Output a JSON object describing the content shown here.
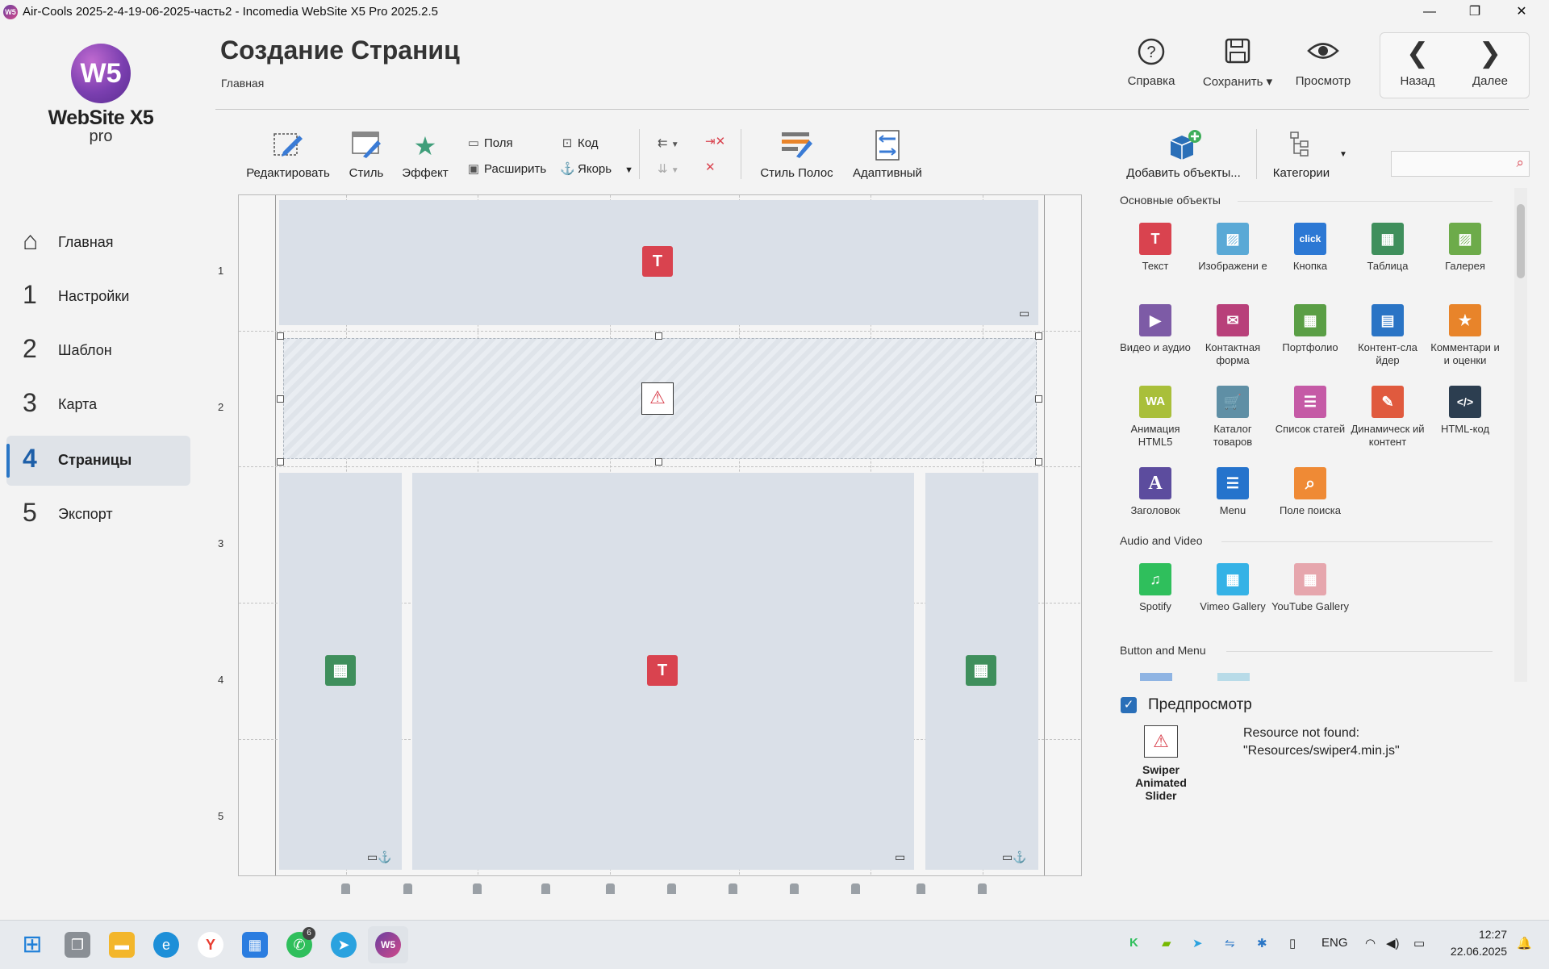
{
  "window": {
    "title": "Air-Cools 2025-2-4-19-06-2025-часть2 - Incomedia WebSite X5 Pro 2025.2.5",
    "app_icon": "W5",
    "controls": [
      "—",
      "❐",
      "✕"
    ]
  },
  "logo": {
    "mark": "W5",
    "name": "WebSite X5",
    "edition": "pro"
  },
  "sidebar": {
    "items": [
      {
        "num": "⌂",
        "label": "Главная",
        "icon": "home-icon"
      },
      {
        "num": "1",
        "label": "Настройки"
      },
      {
        "num": "2",
        "label": "Шаблон"
      },
      {
        "num": "3",
        "label": "Карта"
      },
      {
        "num": "4",
        "label": "Страницы",
        "active": true
      },
      {
        "num": "5",
        "label": "Экспорт"
      }
    ]
  },
  "header": {
    "title": "Создание Страниц",
    "breadcrumb": "Главная",
    "help": {
      "label": "Справка",
      "icon": "?"
    },
    "save": {
      "label": "Сохранить ▾",
      "icon": "💾"
    },
    "preview": {
      "label": "Просмотр",
      "icon": "👁"
    },
    "back": {
      "label": "Назад",
      "icon": "❮"
    },
    "next": {
      "label": "Далее",
      "icon": "❯"
    }
  },
  "toolbar": {
    "edit": "Редактировать",
    "style": "Стиль",
    "effect": "Эффект",
    "fields": "Поля",
    "expand": "Расширить",
    "code": "Код",
    "anchor": "Якорь",
    "strip_style": "Стиль Полос",
    "adaptive": "Адаптивный",
    "add_objects": "Добавить объекты...",
    "categories": "Категории",
    "search_placeholder": ""
  },
  "rows": [
    "1",
    "2",
    "3",
    "4",
    "5"
  ],
  "panel": {
    "sections": [
      {
        "title": "Основные объекты",
        "tiles": [
          {
            "label": "Текст",
            "glyph": "T",
            "color": "#d9434f"
          },
          {
            "label": "Изображени е",
            "glyph": "▨",
            "color": "#5aa9d6"
          },
          {
            "label": "Кнопка",
            "glyph": "click",
            "color": "#2c78d4"
          },
          {
            "label": "Таблица",
            "glyph": "▦",
            "color": "#3f8f5c"
          },
          {
            "label": "Галерея",
            "glyph": "▨",
            "color": "#6dab4a"
          },
          {
            "label": "Видео и аудио",
            "glyph": "▶",
            "color": "#7d5ba6"
          },
          {
            "label": "Контактная форма",
            "glyph": "✉",
            "color": "#b8407a"
          },
          {
            "label": "Портфолио",
            "glyph": "▦",
            "color": "#5a9e45"
          },
          {
            "label": "Контент-сла йдер",
            "glyph": "▤",
            "color": "#2a74c5"
          },
          {
            "label": "Комментари и и оценки",
            "glyph": "★",
            "color": "#e8842a"
          },
          {
            "label": "Анимация HTML5",
            "glyph": "WA",
            "color": "#a9bf3a"
          },
          {
            "label": "Каталог товаров",
            "glyph": "🛒",
            "color": "#5f8fa5"
          },
          {
            "label": "Список статей",
            "glyph": "☰",
            "color": "#c55aa6"
          },
          {
            "label": "Динамическ ий контент",
            "glyph": "✎",
            "color": "#e05a3e"
          },
          {
            "label": "HTML-код",
            "glyph": "</>",
            "color": "#2c3e50"
          },
          {
            "label": "Заголовок",
            "glyph": "A",
            "color": "#5c4c9e"
          },
          {
            "label": "Menu",
            "glyph": "☰",
            "color": "#2573cc"
          },
          {
            "label": "Поле поиска",
            "glyph": "⌕",
            "color": "#ef8a35"
          }
        ]
      },
      {
        "title": "Audio and Video",
        "tiles": [
          {
            "label": "Spotify",
            "glyph": "♫",
            "color": "#2fbf5c"
          },
          {
            "label": "Vimeo Gallery",
            "glyph": "▦",
            "color": "#35b2e6"
          },
          {
            "label": "YouTube Gallery",
            "glyph": "▦",
            "color": "#e6a6ad"
          }
        ]
      },
      {
        "title": "Button and Menu",
        "tiles": []
      }
    ]
  },
  "preview": {
    "checkbox_label": "Предпросмотр",
    "checked": true,
    "object_name": "Swiper Animated Slider",
    "message_line1": "Resource not found:",
    "message_line2": "\"Resources/swiper4.min.js\""
  },
  "taskbar": {
    "whatsapp_badge": "6",
    "lang": "ENG",
    "time": "12:27",
    "date": "22.06.2025"
  }
}
